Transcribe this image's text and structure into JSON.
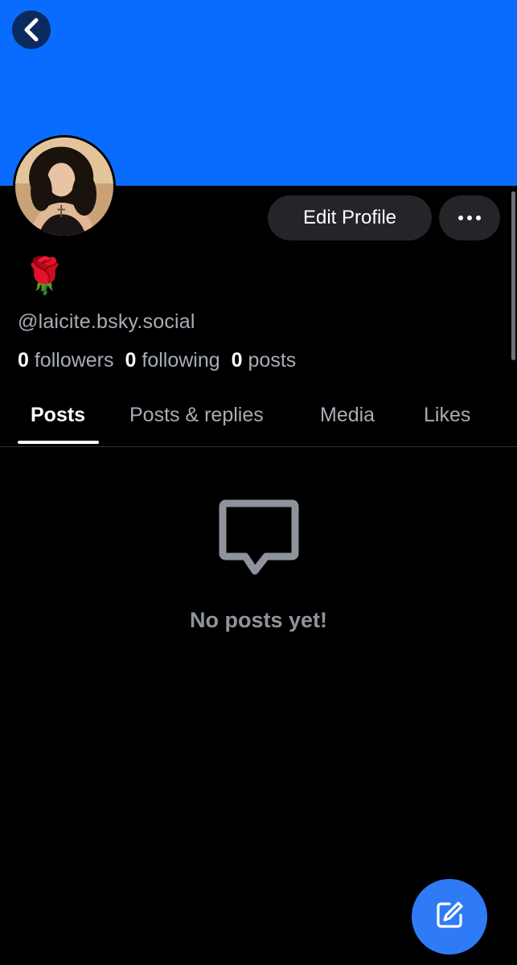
{
  "header": {
    "banner_color": "#0a6cff",
    "back_icon": "chevron-left-icon"
  },
  "profile": {
    "display_name": "🌹",
    "handle": "@laicite.bsky.social",
    "edit_label": "Edit Profile",
    "more_icon": "more-horizontal-icon",
    "stats": {
      "followers_count": "0",
      "followers_label": "followers",
      "following_count": "0",
      "following_label": "following",
      "posts_count": "0",
      "posts_label": "posts"
    }
  },
  "tabs": [
    {
      "label": "Posts",
      "active": true
    },
    {
      "label": "Posts & replies",
      "active": false
    },
    {
      "label": "Media",
      "active": false
    },
    {
      "label": "Likes",
      "active": false
    }
  ],
  "feed": {
    "empty_icon": "message-square-icon",
    "empty_text": "No posts yet!"
  },
  "fab": {
    "icon": "compose-icon",
    "color": "#2f7bf5"
  }
}
